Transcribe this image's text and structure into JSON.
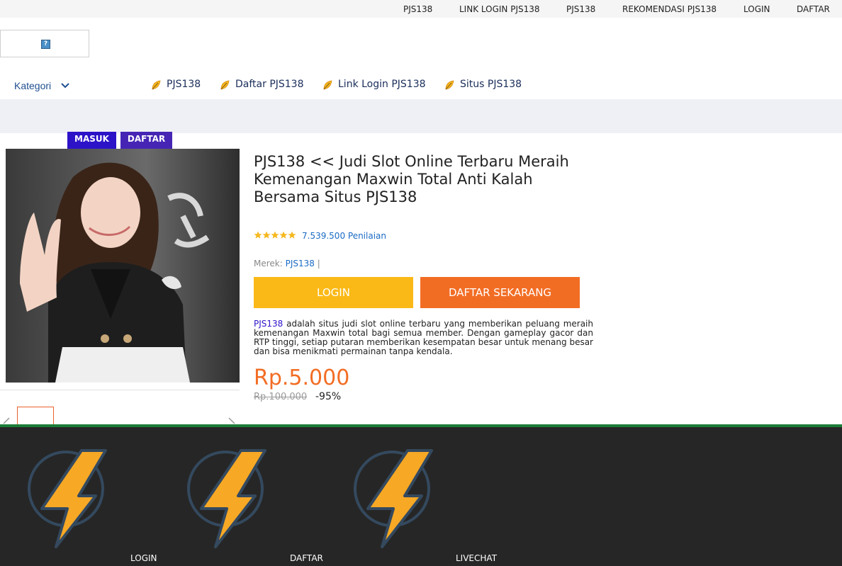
{
  "topbar": {
    "links": [
      "PJS138",
      "LINK LOGIN PJS138",
      "PJS138",
      "REKOMENDASI PJS138",
      "LOGIN",
      "DAFTAR"
    ]
  },
  "nav": {
    "category_label": "Kategori",
    "items": [
      "PJS138",
      "Daftar PJS138",
      "Link Login PJS138",
      "Situs PJS138"
    ]
  },
  "tags": {
    "masuk": "MASUK",
    "daftar": "DAFTAR"
  },
  "product": {
    "title": "PJS138 << Judi Slot Online Terbaru Meraih Kemenangan Maxwin Total Anti Kalah Bersama Situs PJS138",
    "rating_stars": 5,
    "reviews": "7.539.500 Penilaian",
    "brand_label": "Merek:",
    "brand_name": "PJS138",
    "brand_sep": "|",
    "login_label": "LOGIN",
    "daftar_label": "DAFTAR SEKARANG",
    "desc_link": "PJS138",
    "desc_text": " adalah situs judi slot online terbaru yang memberikan peluang meraih kemenangan Maxwin total bagi semua member. Dengan gameplay gacor dan RTP tinggi, setiap putaran memberikan kesempatan besar untuk menang besar dan bisa menikmati permainan tanpa kendala.",
    "price": "Rp.5.000",
    "old_price": "Rp.100.000",
    "discount": "-95%"
  },
  "footer": {
    "items": [
      "LOGIN",
      "DAFTAR",
      "LIVECHAT"
    ]
  },
  "colors": {
    "accent_orange": "#f26d24",
    "login_yellow": "#fbb917",
    "tag_blue": "#2c13c8",
    "footer_bg": "#262626",
    "footer_border": "#1b7d38"
  },
  "icons": [
    "image-placeholder-icon",
    "chevron-down-icon",
    "leaf-icon",
    "star-icon",
    "arrow-left-icon",
    "arrow-right-icon",
    "lightning-icon"
  ]
}
